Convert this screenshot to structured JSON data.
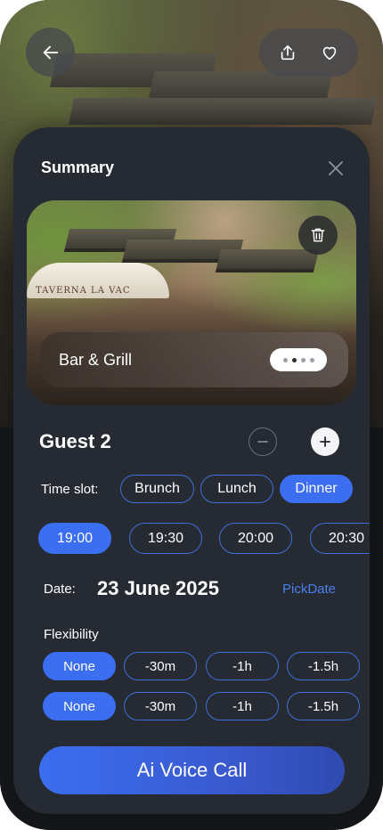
{
  "header": {
    "back_icon": "arrow-left-icon",
    "share_icon": "share-icon",
    "favorite_icon": "heart-icon"
  },
  "sheet": {
    "title": "Summary",
    "close_icon": "close-icon"
  },
  "card": {
    "name": "Bar & Grill",
    "photo_sign": "TAVERNA  LA VAC",
    "delete_icon": "trash-icon",
    "pager": {
      "count": 4,
      "active_index": 1
    }
  },
  "guests": {
    "label": "Guest 2",
    "minus_icon": "minus-icon",
    "plus_icon": "plus-icon"
  },
  "time_slot": {
    "label": "Time slot:",
    "options": [
      "Brunch",
      "Lunch",
      "Dinner"
    ],
    "selected": "Dinner"
  },
  "times": {
    "options": [
      "19:00",
      "19:30",
      "20:00",
      "20:30"
    ],
    "selected": "19:00"
  },
  "date": {
    "label": "Date:",
    "value": "23 June 2025",
    "pick_label": "PickDate"
  },
  "flexibility": {
    "label": "Flexibility",
    "rows": [
      {
        "options": [
          "None",
          "-30m",
          "-1h",
          "-1.5h"
        ],
        "selected": "None"
      },
      {
        "options": [
          "None",
          "-30m",
          "-1h",
          "-1.5h"
        ],
        "selected": "None"
      }
    ]
  },
  "cta": {
    "label": "Ai Voice Call"
  },
  "colors": {
    "accent": "#3b6ef0",
    "sheet_bg": "#262b33",
    "link": "#4a7ff0"
  }
}
